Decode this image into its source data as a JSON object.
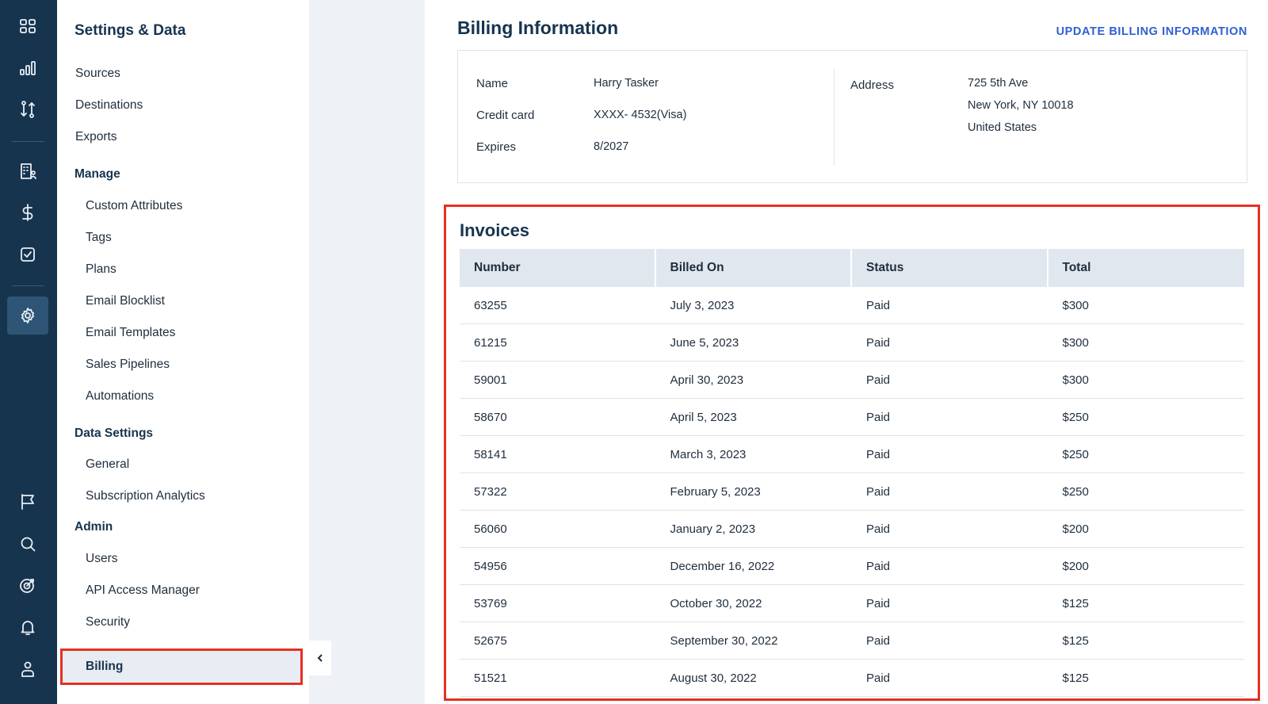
{
  "rail": {
    "icons": [
      "grid-icon",
      "bar-chart-icon",
      "flow-icon",
      "building-icon",
      "dollar-icon",
      "checkbox-icon",
      "settings-icon",
      "flag-icon",
      "search-icon",
      "target-icon",
      "bell-icon",
      "user-icon"
    ],
    "active": "settings-icon"
  },
  "sidebar": {
    "title": "Settings & Data",
    "items_top": [
      "Sources",
      "Destinations",
      "Exports"
    ],
    "manage_header": "Manage",
    "manage_items": [
      "Custom Attributes",
      "Tags",
      "Plans",
      "Email Blocklist",
      "Email Templates",
      "Sales Pipelines",
      "Automations"
    ],
    "data_settings_header": "Data Settings",
    "data_settings_items": [
      "General",
      "Subscription Analytics"
    ],
    "admin_header": "Admin",
    "admin_items": [
      "Users",
      "API Access Manager",
      "Security"
    ],
    "active_item": "Billing"
  },
  "billing": {
    "title": "Billing Information",
    "update_link": "UPDATE BILLING INFORMATION",
    "name_label": "Name",
    "name_value": "Harry Tasker",
    "card_label": "Credit card",
    "card_value": "XXXX- 4532(Visa)",
    "expires_label": "Expires",
    "expires_value": "8/2027",
    "address_label": "Address",
    "address_line1": "725 5th Ave",
    "address_line2": "New York, NY  10018",
    "address_line3": "United States"
  },
  "invoices": {
    "title": "Invoices",
    "columns": [
      "Number",
      "Billed On",
      "Status",
      "Total"
    ],
    "rows": [
      [
        "63255",
        "July 3, 2023",
        "Paid",
        "$300"
      ],
      [
        "61215",
        "June 5, 2023",
        "Paid",
        "$300"
      ],
      [
        "59001",
        "April 30, 2023",
        "Paid",
        "$300"
      ],
      [
        "58670",
        "April 5, 2023",
        "Paid",
        "$250"
      ],
      [
        "58141",
        "March 3, 2023",
        "Paid",
        "$250"
      ],
      [
        "57322",
        "February 5, 2023",
        "Paid",
        "$250"
      ],
      [
        "56060",
        "January 2, 2023",
        "Paid",
        "$200"
      ],
      [
        "54956",
        "December 16, 2022",
        "Paid",
        "$200"
      ],
      [
        "53769",
        "October 30, 2022",
        "Paid",
        "$125"
      ],
      [
        "52675",
        "September 30, 2022",
        "Paid",
        "$125"
      ],
      [
        "51521",
        "August 30, 2022",
        "Paid",
        "$125"
      ]
    ]
  }
}
